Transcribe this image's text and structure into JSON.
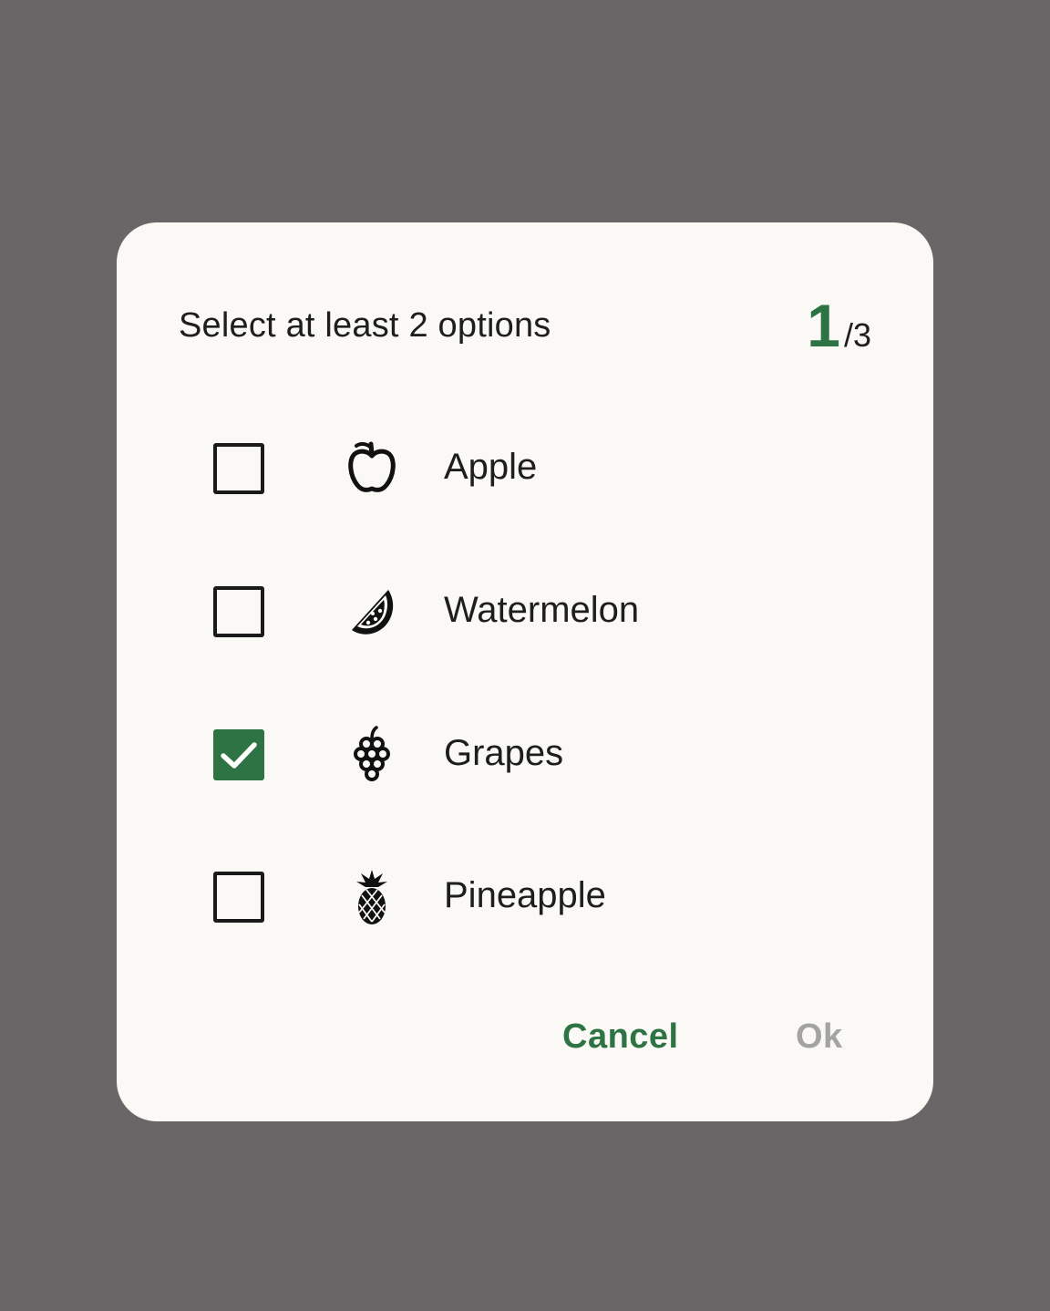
{
  "dialog": {
    "title": "Select at least 2 options",
    "counter": {
      "current": "1",
      "total": "/3"
    },
    "options": [
      {
        "label": "Apple",
        "icon": "apple-icon",
        "checked": false
      },
      {
        "label": "Watermelon",
        "icon": "watermelon-icon",
        "checked": false
      },
      {
        "label": "Grapes",
        "icon": "grapes-icon",
        "checked": true
      },
      {
        "label": "Pineapple",
        "icon": "pineapple-icon",
        "checked": false
      }
    ],
    "buttons": {
      "cancel": "Cancel",
      "ok": "Ok"
    }
  },
  "colors": {
    "accent": "#2e7343",
    "scrim": "#686666",
    "surface": "#fbf9f6",
    "disabled": "#a3a3a3"
  }
}
